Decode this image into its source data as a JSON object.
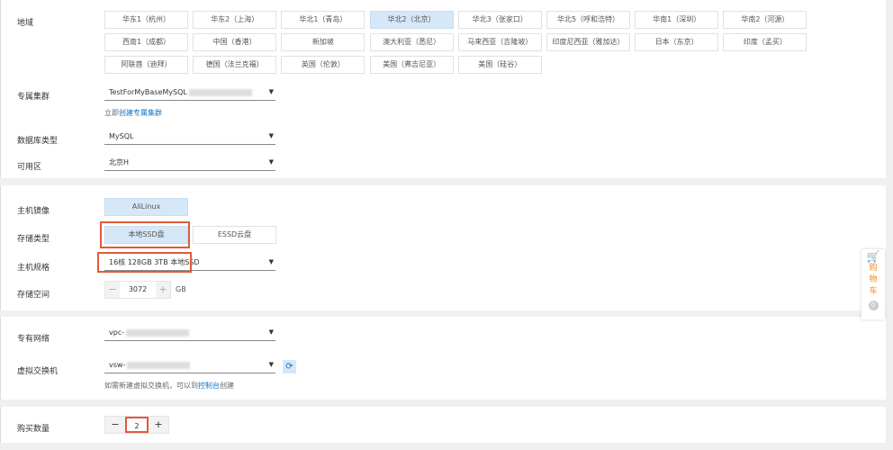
{
  "region": {
    "label": "地域",
    "options": [
      "华东1（杭州）",
      "华东2（上海）",
      "华北1（青岛）",
      "华北2（北京）",
      "华北3（张家口）",
      "华北5（呼和浩特）",
      "华南1（深圳）",
      "华南2（河源）",
      "西南1（成都）",
      "中国（香港）",
      "新加坡",
      "澳大利亚（悉尼）",
      "马来西亚（吉隆坡）",
      "印度尼西亚（雅加达）",
      "日本（东京）",
      "印度（孟买）",
      "阿联酋（迪拜）",
      "德国（法兰克福）",
      "英国（伦敦）",
      "美国（弗吉尼亚）",
      "美国（硅谷）"
    ],
    "selected": "华北2（北京）"
  },
  "cluster": {
    "label": "专属集群",
    "value": "TestForMyBaseMySQL",
    "hint_prefix": "立即",
    "hint_link": "创建专属集群"
  },
  "db_type": {
    "label": "数据库类型",
    "value": "MySQL"
  },
  "zone": {
    "label": "可用区",
    "value": "北京H"
  },
  "image": {
    "label": "主机镜像",
    "value": "AliLinux"
  },
  "storage_type": {
    "label": "存储类型",
    "options": [
      "本地SSD盘",
      "ESSD云盘"
    ],
    "selected": "本地SSD盘"
  },
  "spec": {
    "label": "主机规格",
    "value": "16核 128GB 3TB 本地SSD"
  },
  "storage": {
    "label": "存储空间",
    "value": "3072",
    "unit": "GB",
    "minus": "−",
    "plus": "+"
  },
  "vpc": {
    "label": "专有网络",
    "value": "vpc-"
  },
  "vswitch": {
    "label": "虚拟交换机",
    "value": "vsw-",
    "hint_prefix": "如需新建虚拟交换机，可以到",
    "hint_link": "控制台",
    "hint_suffix": "创建"
  },
  "quantity": {
    "label": "购买数量",
    "value": "2",
    "minus": "−",
    "plus": "+"
  },
  "cart": {
    "label1": "购",
    "label2": "物",
    "label3": "车",
    "count": "0",
    "color": "#f08a24"
  },
  "accent": "#0a70c8"
}
